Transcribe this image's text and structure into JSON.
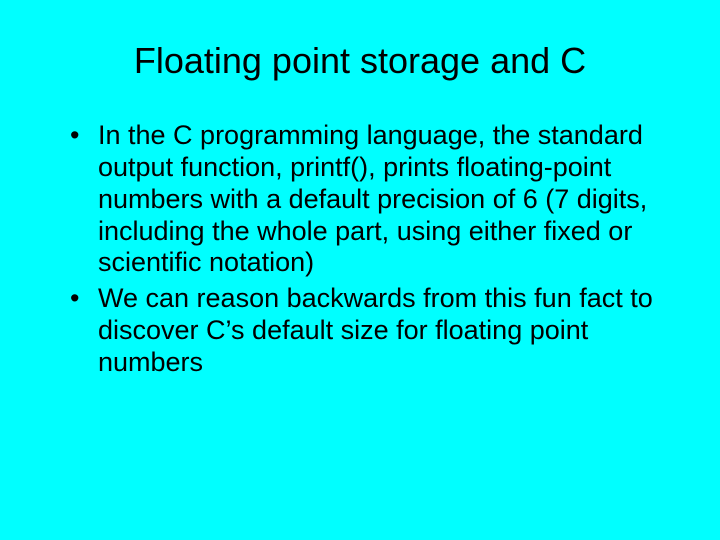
{
  "slide": {
    "title": "Floating point storage and C",
    "bullets": [
      "In the C programming language, the standard output function, printf(), prints floating-point numbers with a default precision of 6 (7 digits, including the whole part, using either fixed or scientific notation)",
      "We can reason backwards from this fun fact to discover C’s default size for floating point numbers"
    ]
  }
}
